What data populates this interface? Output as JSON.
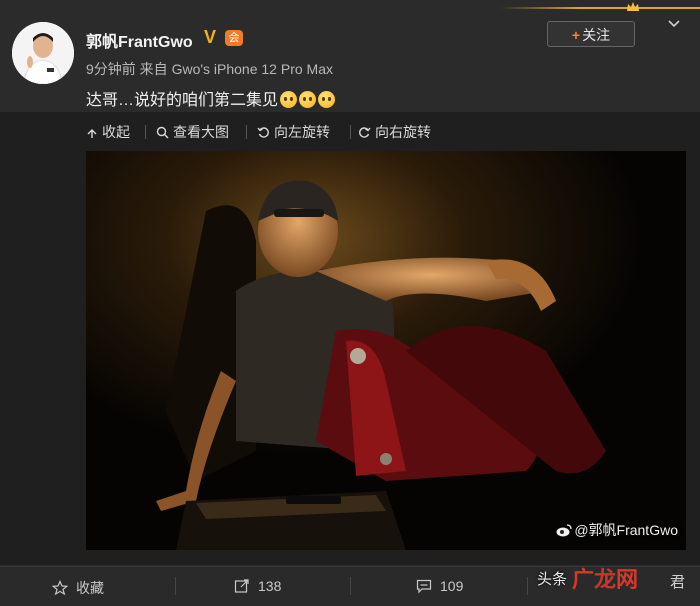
{
  "post": {
    "username": "郭帆FrantGwo",
    "verified_mark": "V",
    "member_mark": "会",
    "meta": "9分钟前  来自 Gwo's iPhone 12 Pro Max",
    "content_text": "达哥…说好的咱们第二集见",
    "follow_plus": "+",
    "follow_label": "关注"
  },
  "toolbar": {
    "collapse": "收起",
    "view_large": "查看大图",
    "rotate_left": "向左旋转",
    "rotate_right": "向右旋转"
  },
  "photo": {
    "watermark": "@郭帆FrantGwo"
  },
  "actions": {
    "favorite": "收藏",
    "repost_count": "138",
    "comment_count": "109"
  },
  "overlay": {
    "toutiao": "头条",
    "logo_main": "广",
    "logo_sub": "龙",
    "logo_tail": "网",
    "tail_char": "君"
  },
  "colors": {
    "accent": "#ff8140",
    "gold": "#d9a62f",
    "background": "#2b2b2b"
  },
  "icons": [
    "collapse-icon",
    "search-icon",
    "rotate-left-icon",
    "rotate-right-icon",
    "star-icon",
    "share-icon",
    "comment-icon",
    "chevron-down-icon",
    "crown-icon",
    "weibo-icon"
  ]
}
